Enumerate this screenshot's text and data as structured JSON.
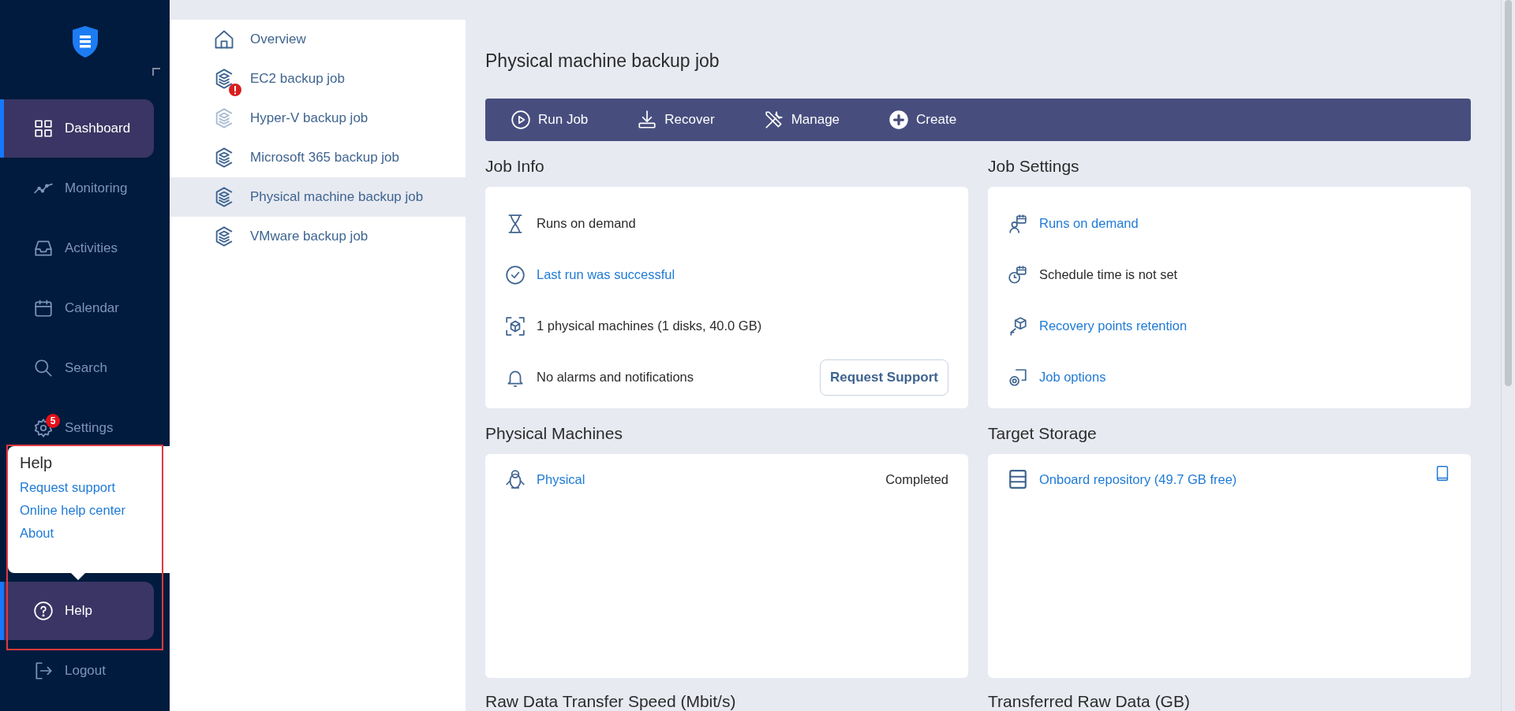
{
  "sidebar": {
    "items": [
      {
        "label": "Dashboard",
        "selected": true
      },
      {
        "label": "Monitoring",
        "selected": false
      },
      {
        "label": "Activities",
        "selected": false
      },
      {
        "label": "Calendar",
        "selected": false
      },
      {
        "label": "Search",
        "selected": false
      },
      {
        "label": "Settings",
        "selected": false,
        "badge": "5"
      }
    ],
    "bottom_items": [
      {
        "label": "Help",
        "selected": true
      },
      {
        "label": "Logout",
        "selected": false
      }
    ]
  },
  "help_popup": {
    "title": "Help",
    "links": [
      "Request support",
      "Online help center",
      "About"
    ]
  },
  "job_list": [
    {
      "label": "Overview",
      "kind": "home",
      "selected": false,
      "error": false,
      "disabled": false
    },
    {
      "label": "EC2 backup job",
      "kind": "job",
      "selected": false,
      "error": true,
      "disabled": false
    },
    {
      "label": "Hyper-V backup job",
      "kind": "job",
      "selected": false,
      "error": false,
      "disabled": true
    },
    {
      "label": "Microsoft 365 backup job",
      "kind": "job",
      "selected": false,
      "error": false,
      "disabled": false
    },
    {
      "label": "Physical machine backup job",
      "kind": "job",
      "selected": true,
      "error": false,
      "disabled": false
    },
    {
      "label": "VMware backup job",
      "kind": "job",
      "selected": false,
      "error": false,
      "disabled": false
    }
  ],
  "page_title": "Physical machine backup job",
  "toolbar": [
    {
      "label": "Run Job"
    },
    {
      "label": "Recover"
    },
    {
      "label": "Manage"
    },
    {
      "label": "Create"
    }
  ],
  "job_info": {
    "title": "Job Info",
    "rows": [
      {
        "text": "Runs on demand",
        "link": false
      },
      {
        "text": "Last run was successful",
        "link": true
      },
      {
        "text": "1 physical machines (1 disks, 40.0 GB)",
        "link": false
      },
      {
        "text": "No alarms and notifications",
        "link": false
      }
    ],
    "button": "Request Support"
  },
  "job_settings": {
    "title": "Job Settings",
    "rows": [
      {
        "text": "Runs on demand",
        "link": true
      },
      {
        "text": "Schedule time is not set",
        "link": false
      },
      {
        "text": "Recovery points retention",
        "link": true
      },
      {
        "text": "Job options",
        "link": true
      }
    ]
  },
  "physical_machines": {
    "title": "Physical Machines",
    "rows": [
      {
        "name": "Physical",
        "status": "Completed"
      }
    ]
  },
  "target_storage": {
    "title": "Target Storage",
    "rows": [
      {
        "name": "Onboard repository (49.7 GB free)"
      }
    ]
  },
  "bottom_headings": [
    "Raw Data Transfer Speed (Mbit/s)",
    "Transferred Raw Data (GB)"
  ]
}
